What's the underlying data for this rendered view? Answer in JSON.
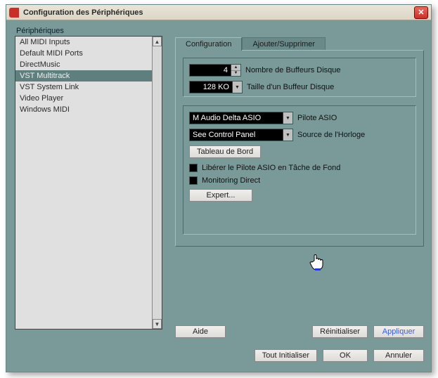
{
  "window": {
    "title": "Configuration des Périphériques"
  },
  "sidebar": {
    "heading": "Périphériques",
    "items": [
      {
        "label": "All MIDI Inputs"
      },
      {
        "label": "Default MIDI Ports"
      },
      {
        "label": "DirectMusic"
      },
      {
        "label": "VST Multitrack",
        "selected": true
      },
      {
        "label": "VST System Link"
      },
      {
        "label": "Video Player"
      },
      {
        "label": "Windows MIDI"
      }
    ]
  },
  "tabs": {
    "configuration": "Configuration",
    "add_remove": "Ajouter/Supprimer",
    "active": "configuration"
  },
  "settings": {
    "disk_buffers": {
      "value": "4",
      "label": "Nombre de Buffeurs Disque"
    },
    "disk_buffer_size": {
      "value": "128 KO",
      "label": "Taille d'un Buffeur Disque"
    },
    "asio_driver": {
      "value": "M Audio Delta ASIO",
      "label": "Pilote ASIO"
    },
    "clock_source": {
      "value": "See Control Panel",
      "label": "Source de l'Horloge"
    },
    "control_panel_button": "Tableau de Bord",
    "release_background": {
      "label": "Libérer le Pilote ASIO en Tâche de Fond",
      "checked": false
    },
    "direct_monitoring": {
      "label": "Monitoring Direct",
      "checked": false
    },
    "expert_button": "Expert..."
  },
  "buttons": {
    "help": "Aide",
    "reset": "Réinitialiser",
    "apply": "Appliquer",
    "init_all": "Tout Initialiser",
    "ok": "OK",
    "cancel": "Annuler"
  }
}
